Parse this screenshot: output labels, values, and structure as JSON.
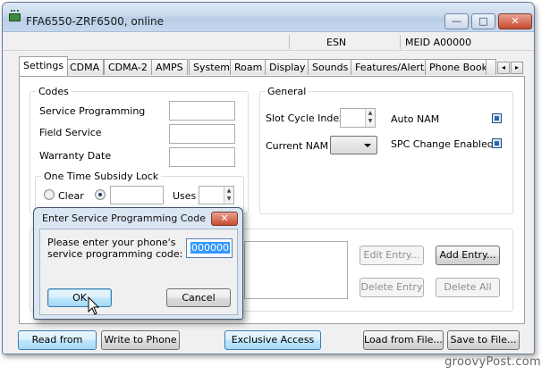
{
  "window": {
    "title": "FFA6550-ZRF6500, online",
    "controls": {
      "minimize": "—",
      "maximize": "□",
      "close": "✕"
    }
  },
  "status": {
    "esn_label": "ESN",
    "meid_label": "MEID A00000"
  },
  "tabs": [
    "Settings",
    "CDMA",
    "CDMA-2",
    "AMPS",
    "System",
    "Roam",
    "Display",
    "Sounds",
    "Features/Alerts",
    "Phone Book"
  ],
  "tab_scroll": {
    "left": "◂",
    "right": "▸"
  },
  "codes": {
    "legend": "Codes",
    "service_programming": "Service Programming",
    "field_service": "Field Service",
    "warranty_date": "Warranty Date"
  },
  "otsl": {
    "legend": "One Time Subsidy Lock",
    "clear": "Clear",
    "uses": "Uses"
  },
  "general": {
    "legend": "General",
    "slot_cycle_index": "Slot Cycle Index",
    "current_nam": "Current NAM",
    "auto_nam": "Auto NAM",
    "spc_change_enabled": "SPC Change Enabled"
  },
  "entry_buttons": {
    "edit": "Edit Entry...",
    "add": "Add Entry...",
    "delete": "Delete Entry",
    "delete_all": "Delete All"
  },
  "bottom_buttons": {
    "read": "Read from Phone",
    "write": "Write to Phone",
    "exclusive": "Exclusive Access",
    "load": "Load from File...",
    "save": "Save to File..."
  },
  "dialog": {
    "title": "Enter Service Programming Code",
    "close": "✕",
    "prompt_line1": "Please enter your phone's",
    "prompt_line2": "service programming code:",
    "code_value": "000000",
    "ok": "OK",
    "cancel": "Cancel"
  },
  "watermark": "groovyPost.com",
  "colors": {
    "accent": "#3c7fb1",
    "checkbox_fill": "#2a5f9e",
    "close_button": "#c84a30"
  }
}
